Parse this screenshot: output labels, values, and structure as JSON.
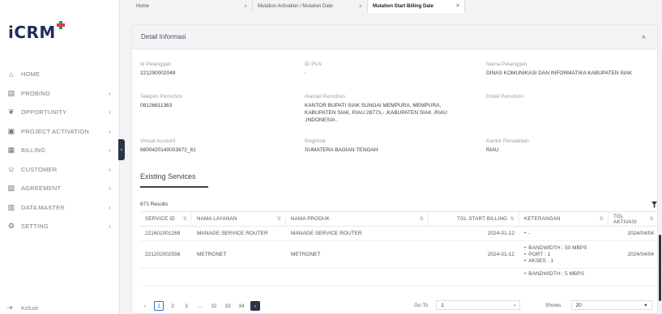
{
  "app": {
    "logo_text": "iCRM",
    "brand_colors": {
      "navy": "#1f2d5a",
      "green": "#1e9e4f",
      "red": "#e23b3b",
      "dark_button": "#2a3544",
      "active_blue": "#2f6ad6"
    }
  },
  "tabs": [
    {
      "label": "Home",
      "close": "×",
      "active": false
    },
    {
      "label": "Mutation Activation / Mutation Date",
      "close": "×",
      "active": false
    },
    {
      "label": "Mutation Start Billing Date",
      "close": "×",
      "active": true
    }
  ],
  "sidebar": {
    "items": [
      {
        "label": "HOME",
        "icon": "home-icon",
        "glyph": "⌂",
        "chevron": ""
      },
      {
        "label": "PROBING",
        "icon": "document-icon",
        "glyph": "▤",
        "chevron": "›"
      },
      {
        "label": "OPPORTUNITY",
        "icon": "handshake-icon",
        "glyph": "❦",
        "chevron": "›"
      },
      {
        "label": "PROJECT ACTIVATION",
        "icon": "clipboard-icon",
        "glyph": "▣",
        "chevron": "›"
      },
      {
        "label": "BILLING",
        "icon": "invoice-icon",
        "glyph": "▦",
        "chevron": "›"
      },
      {
        "label": "CUSTOMER",
        "icon": "people-icon",
        "glyph": "☺",
        "chevron": "›"
      },
      {
        "label": "AGREEMENT",
        "icon": "contract-icon",
        "glyph": "▧",
        "chevron": "›"
      },
      {
        "label": "DATA MASTER",
        "icon": "database-icon",
        "glyph": "▥",
        "chevron": "›"
      },
      {
        "label": "SETTING",
        "icon": "settings-icon",
        "glyph": "⚙",
        "chevron": "›"
      }
    ],
    "logout_label": "Keluar",
    "collapse_glyph": "‹"
  },
  "detail": {
    "title": "Detail Informasi",
    "collapse_glyph": "˄",
    "fields": {
      "id_pelanggan": {
        "label": "Id Pelanggan",
        "value": "221290002049"
      },
      "id_pln": {
        "label": "ID PLN",
        "value": "-"
      },
      "nama_pelanggan": {
        "label": "Nama Pelanggan",
        "value": "DINAS KOMUNIKASI DAN INFORMATIKA KABUPATEN SIAK"
      },
      "telepon": {
        "label": "Telepon Pemohon",
        "value": "08126611363"
      },
      "alamat": {
        "label": "Alamat Pemohon",
        "value": "KANTOR BUPATI SIAK SUNGAI MEMPURA, MEMPURA, KABUPATEN SIAK, RIAU 28773,- ,KABUPATEN SIAK ,RIAU ,INDONESIA ,"
      },
      "email": {
        "label": "Email Pemohon",
        "value": ""
      },
      "virtual_account": {
        "label": "Virtual Account",
        "value": "8800420140003972_61"
      },
      "regional": {
        "label": "Regional",
        "value": "SUMATERA BAGIAN TENGAH"
      },
      "kantor": {
        "label": "Kantor Perwakilan",
        "value": "RIAU"
      }
    }
  },
  "services": {
    "section_title": "Existing Services",
    "results": "671 Results",
    "columns": [
      "SERVICE ID",
      "NAMA LAYANAN",
      "NAMA PRODUK",
      "TGL START BILLING",
      "KETERANGAN",
      "TGL AKTIVASI"
    ],
    "rows": [
      {
        "service_id": "221601001269",
        "layanan": "MANAGE SERVICE ROUTER",
        "produk": "MANAGE SERVICE ROUTER",
        "start_billing": "2024-01-12",
        "keterangan": [
          "-"
        ],
        "aktivasi": "2024/04/04"
      },
      {
        "service_id": "221202002556",
        "layanan": "METRONET",
        "produk": "METRONET",
        "start_billing": "2024-01-12",
        "keterangan": [
          "BANDWIDTH : 50 MBPS",
          "PORT : 1",
          "AKSES : 1"
        ],
        "aktivasi": "2024/04/04"
      },
      {
        "service_id": "",
        "layanan": "",
        "produk": "",
        "start_billing": "",
        "keterangan": [
          "BANDWIDTH : 5 MBPS"
        ],
        "aktivasi": ""
      }
    ]
  },
  "pagination": {
    "prev": "‹",
    "pages": [
      "1",
      "2",
      "3",
      "...",
      "32",
      "33",
      "34"
    ],
    "active_page": "1",
    "next": "›",
    "goto_label": "Go To",
    "goto_value": "1",
    "goto_arrow": "›",
    "shows_label": "Shows",
    "shows_value": "20",
    "shows_caret": "▾"
  }
}
